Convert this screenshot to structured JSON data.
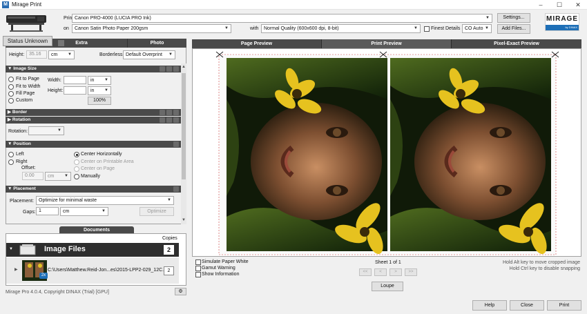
{
  "window": {
    "title": "Mirage Print",
    "app_icon": "M",
    "minimize": "–",
    "maximize": "☐",
    "close": "✕"
  },
  "header": {
    "print_to_label": "Print to",
    "printer": "Canon PRO-4000 (LUCIA PRO Ink)",
    "on_label": "on",
    "paper": "Canon Satin Photo Paper 200gsm",
    "with_label": "with",
    "quality": "Normal Quality (600x600 dpi, 8-bit)",
    "finest_details_label": "Finest Details",
    "color_mode": "CO Auto",
    "settings_button": "Settings...",
    "add_files_button": "Add Files...",
    "logo_text": "MIRAGE",
    "logo_sub": "by DINAX"
  },
  "status": "Status Unknown",
  "left_tabs": [
    "Extra",
    "Photo"
  ],
  "top_fields": {
    "height_label": "Height:",
    "height_value": "35.16",
    "height_unit": "cm",
    "borderless_label": "Borderless:",
    "borderless_value": "Default Overprint"
  },
  "image_size": {
    "title": "Image Size",
    "options": [
      "Fit to Page",
      "Fit to Width",
      "Fill Page",
      "Custom"
    ],
    "width_label": "Width:",
    "height_label": "Height:",
    "width_unit": "in",
    "height_unit": "in",
    "zoom_button": "100%"
  },
  "border": {
    "title": "Border"
  },
  "rotation": {
    "title": "Rotation",
    "label": "Rotation:"
  },
  "position": {
    "title": "Position",
    "left": "Left",
    "right": "Right",
    "offset_label": "Offset:",
    "offset_value": "0.00",
    "offset_unit": "cm",
    "center_h": "Center Horizontally",
    "center_printable": "Center on Printable Area",
    "center_page": "Center on Page",
    "manually": "Manually"
  },
  "placement": {
    "title": "Placement",
    "label": "Placement:",
    "value": "Optimize for minimal waste",
    "gaps_label": "Gaps:",
    "gaps_value": "1",
    "gaps_unit": "cm",
    "optimize_button": "Optimize"
  },
  "documents": {
    "tab": "Documents",
    "copies_header": "Copies",
    "group_name": "Image Files",
    "group_copies": "2",
    "file_path": "C:\\Users\\Matthew.Reid-Jon...es\\2015-LPP2-029_12C.tif",
    "file_copies": "2",
    "badge": "2x"
  },
  "footer": {
    "copyright": "Mirage Pro 4.0.4, Copyright DINAX (Trial) [GPU]"
  },
  "preview_tabs": [
    "Page Preview",
    "Print Preview",
    "Pixel-Exact Preview"
  ],
  "preview": {
    "simulate_paper_white": "Simulate Paper White",
    "gamut_warning": "Gamut Warning",
    "show_information": "Show Information",
    "sheet_label": "Sheet 1 of 1",
    "nav": [
      "<<",
      "<",
      ">",
      ">>"
    ],
    "loupe_button": "Loupe",
    "hint1": "Hold Alt key to move cropped image",
    "hint2": "Hold Ctrl key to disable snapping"
  },
  "buttons": {
    "help": "Help",
    "close": "Close",
    "print": "Print"
  }
}
